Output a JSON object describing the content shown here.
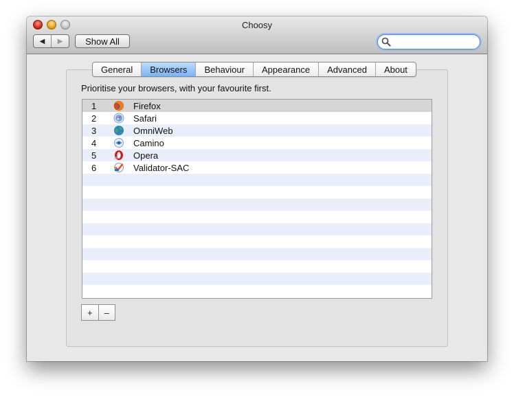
{
  "window": {
    "title": "Choosy"
  },
  "toolbar": {
    "back_glyph": "◀",
    "forward_glyph": "▶",
    "show_all_label": "Show All",
    "search": {
      "value": "",
      "placeholder": ""
    }
  },
  "tabs": [
    {
      "label": "General",
      "selected": false
    },
    {
      "label": "Browsers",
      "selected": true
    },
    {
      "label": "Behaviour",
      "selected": false
    },
    {
      "label": "Appearance",
      "selected": false
    },
    {
      "label": "Advanced",
      "selected": false
    },
    {
      "label": "About",
      "selected": false
    }
  ],
  "browsers_panel": {
    "instructions": "Prioritise your browsers, with your favourite first.",
    "browsers": [
      {
        "rank": "1",
        "name": "Firefox",
        "icon": "firefox-icon",
        "selected": true
      },
      {
        "rank": "2",
        "name": "Safari",
        "icon": "safari-icon",
        "selected": false
      },
      {
        "rank": "3",
        "name": "OmniWeb",
        "icon": "omniweb-icon",
        "selected": false
      },
      {
        "rank": "4",
        "name": "Camino",
        "icon": "camino-icon",
        "selected": false
      },
      {
        "rank": "5",
        "name": "Opera",
        "icon": "opera-icon",
        "selected": false
      },
      {
        "rank": "6",
        "name": "Validator-SAC",
        "icon": "validator-sac-icon",
        "selected": false
      }
    ],
    "add_label": "+",
    "remove_label": "–"
  },
  "colors": {
    "selected_tab": "#7ab4f2",
    "row_stripe": "#e9eefa",
    "row_selected": "#d5d5d5",
    "search_focus": "#5e86c7"
  }
}
